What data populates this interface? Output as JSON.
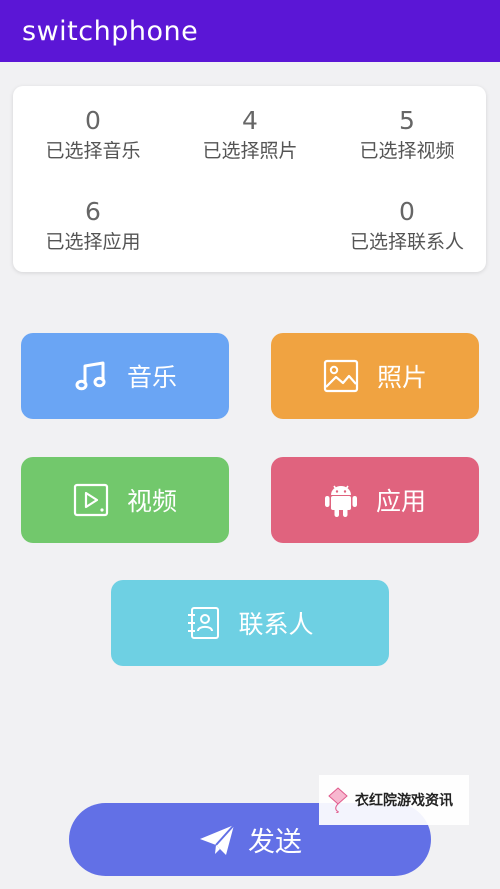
{
  "app": {
    "title": "switchphone"
  },
  "stats": [
    {
      "count": "0",
      "label": "已选择音乐"
    },
    {
      "count": "4",
      "label": "已选择照片"
    },
    {
      "count": "5",
      "label": "已选择视频"
    },
    {
      "count": "6",
      "label": "已选择应用"
    },
    {
      "count": "0",
      "label": "已选择联系人"
    }
  ],
  "categories": {
    "music": {
      "label": "音乐",
      "icon": "music-note-icon",
      "color": "#6aa5f4"
    },
    "photo": {
      "label": "照片",
      "icon": "image-icon",
      "color": "#f0a341"
    },
    "video": {
      "label": "视频",
      "icon": "video-play-icon",
      "color": "#72c86c"
    },
    "app": {
      "label": "应用",
      "icon": "android-icon",
      "color": "#e0637e"
    },
    "contact": {
      "label": "联系人",
      "icon": "contact-book-icon",
      "color": "#6ed0e3"
    }
  },
  "send": {
    "label": "发送",
    "icon": "paper-plane-icon",
    "color": "#6270e6"
  },
  "watermark": {
    "text": "衣红院游戏资讯",
    "icon": "kite-icon"
  },
  "theme": {
    "appbar_color": "#5b16d6",
    "background": "#f1f1f3"
  }
}
